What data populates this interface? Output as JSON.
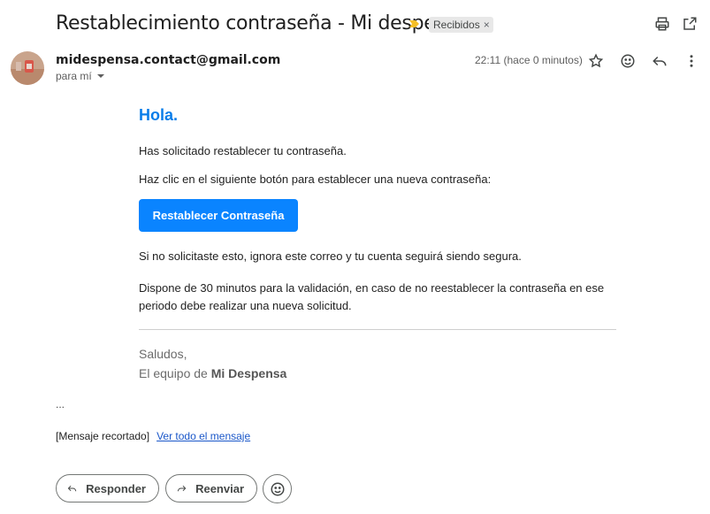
{
  "header": {
    "subject": "Restablecimiento contraseña - Mi despensa",
    "label": "Recibidos",
    "label_remove": "×"
  },
  "message": {
    "sender": "midespensa.contact@gmail.com",
    "recipient": "para mí",
    "timestamp": "22:11 (hace 0 minutos)"
  },
  "body": {
    "greeting": "Hola.",
    "line1": "Has solicitado restablecer tu contraseña.",
    "line2": "Haz clic en el siguiente botón para establecer una nueva contraseña:",
    "cta_label": "Restablecer Contraseña",
    "line3": "Si no solicitaste esto, ignora este correo y tu cuenta seguirá siendo segura.",
    "line4": "Dispone de 30 minutos para la validación, en caso de no reestablecer la contraseña en ese periodo debe realizar una nueva solicitud.",
    "signoff": "Saludos,",
    "team_prefix": "El equipo de ",
    "team_name": "Mi Despensa"
  },
  "trimmed": {
    "ellipsis": "...",
    "clipped_label": "[Mensaje recortado]",
    "view_all": "Ver todo el mensaje"
  },
  "footer": {
    "reply": "Responder",
    "forward": "Reenviar"
  },
  "colors": {
    "accent": "#0a84ff",
    "greeting": "#0a7de9",
    "importance": "#f6bf26",
    "link": "#1a57c9"
  }
}
